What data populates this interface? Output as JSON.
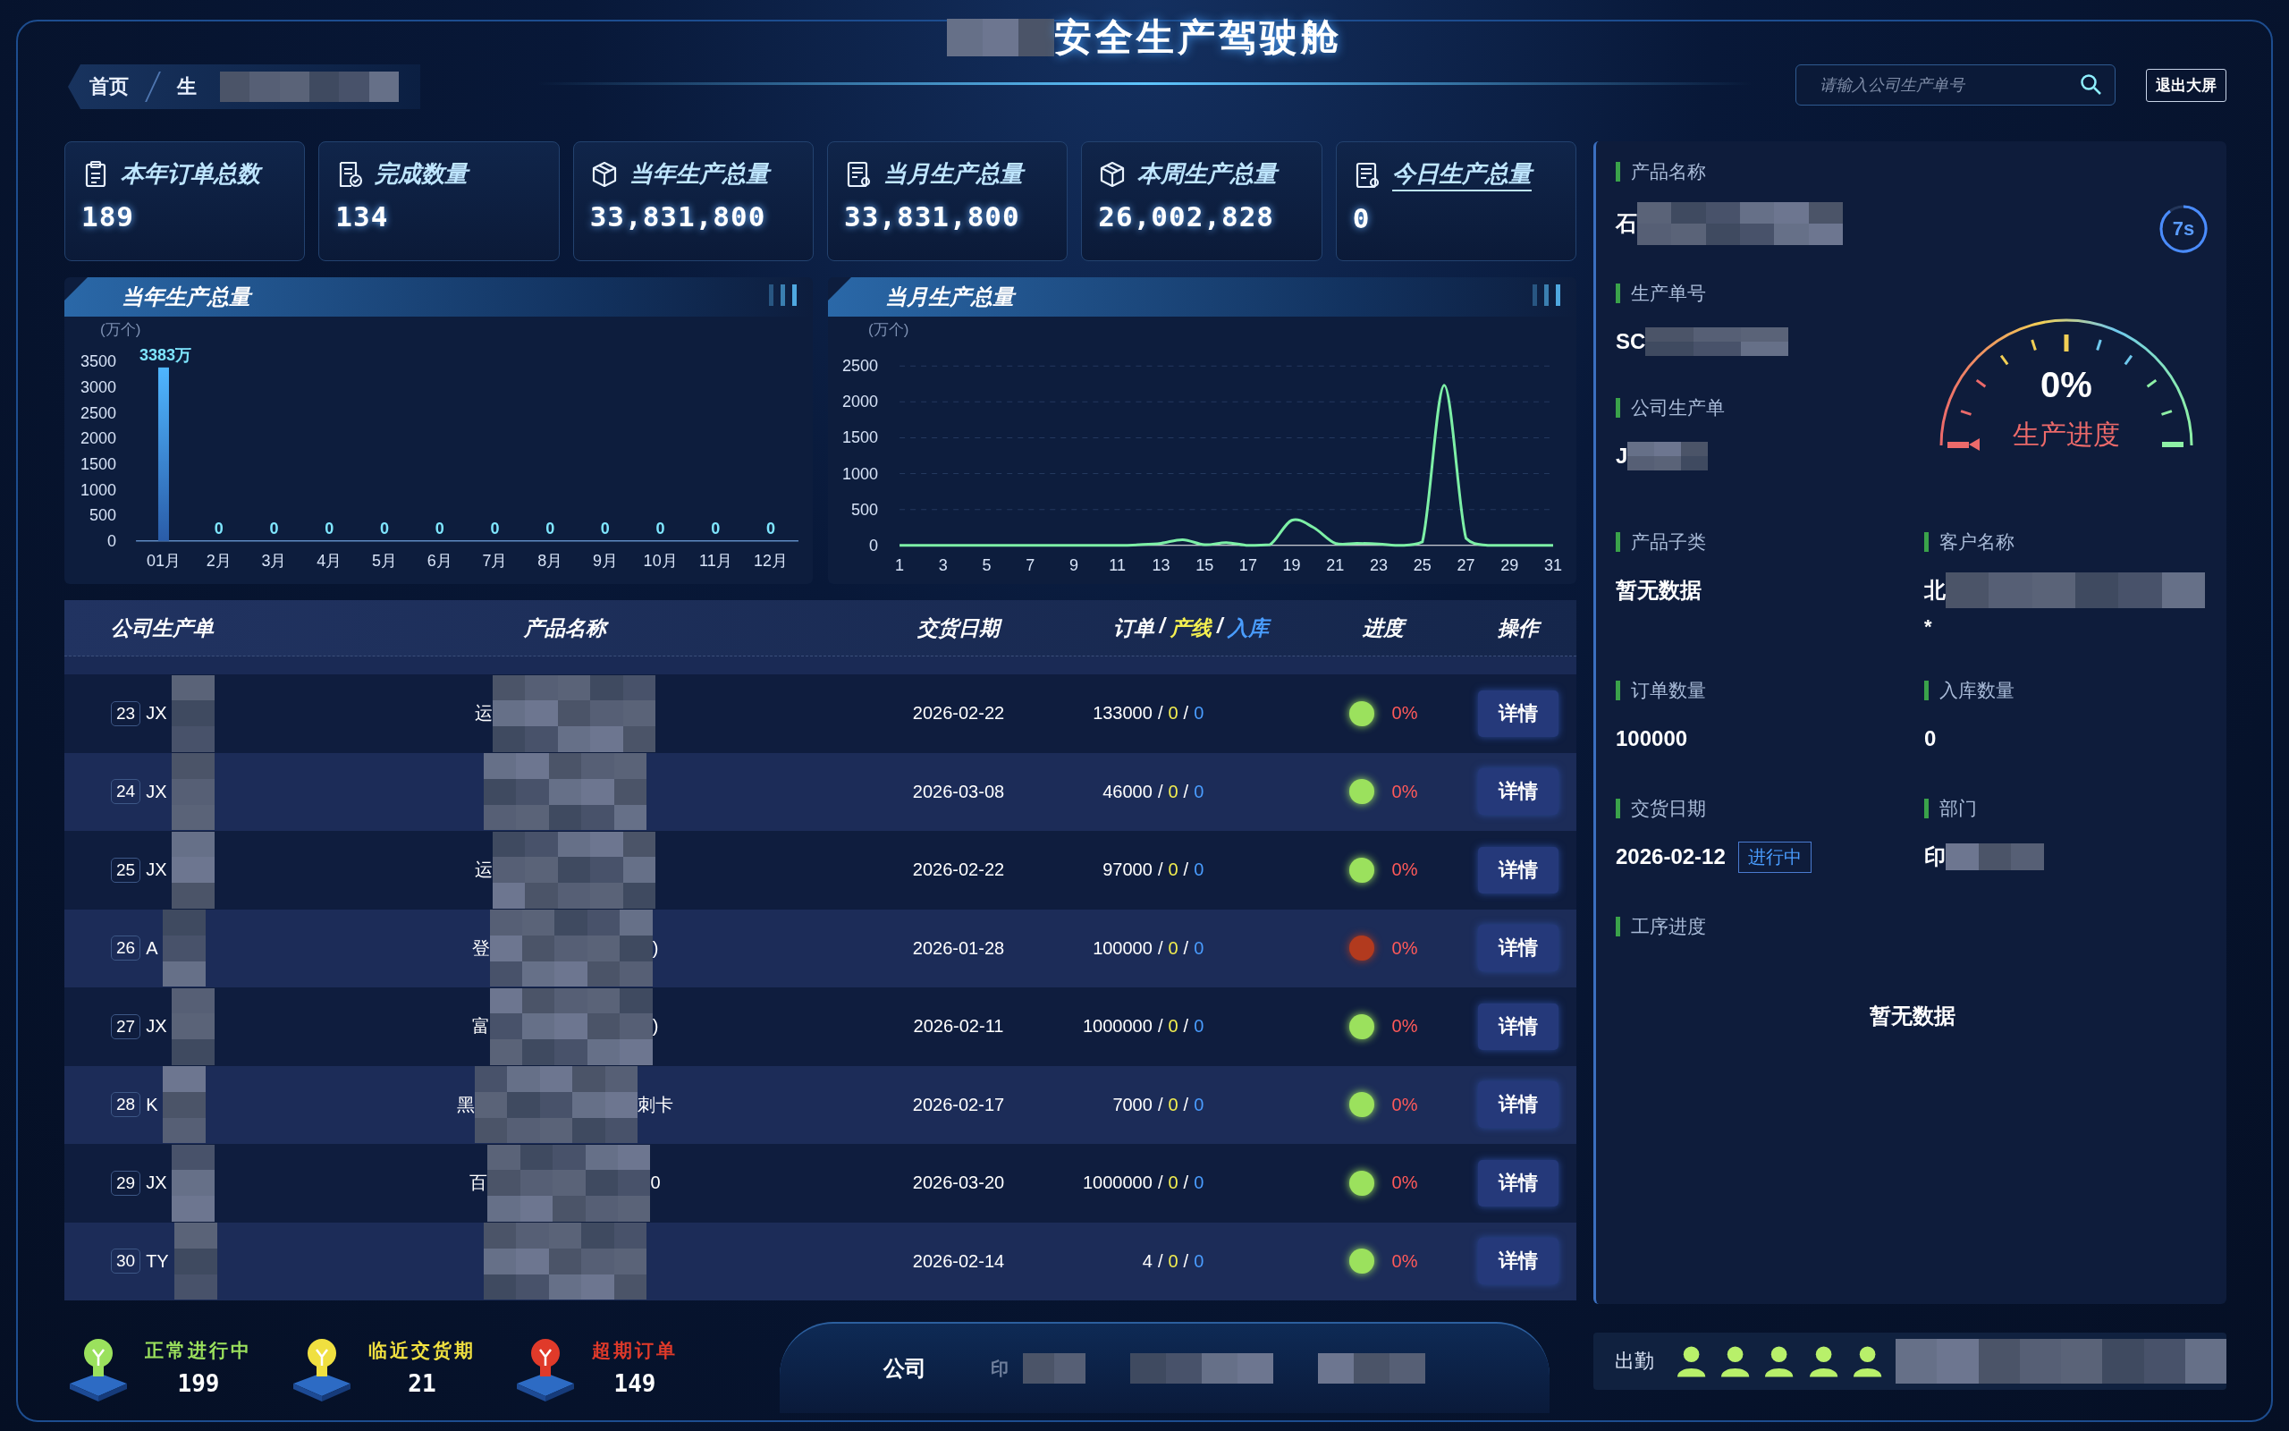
{
  "header": {
    "title": "安全生产驾驶舱",
    "title_blurred": true,
    "breadcrumb": [
      {
        "label": "首页"
      },
      {
        "label": "生",
        "blurred": true
      }
    ],
    "search": {
      "placeholder": "请输入公司生产单号"
    },
    "exit_button": "退出大屏"
  },
  "stats": [
    {
      "label": "本年订单总数",
      "value": "189",
      "selected": false
    },
    {
      "label": "完成数量",
      "value": "134",
      "selected": false
    },
    {
      "label": "当年生产总量",
      "value": "33,831,800",
      "selected": false
    },
    {
      "label": "当月生产总量",
      "value": "33,831,800",
      "selected": false
    },
    {
      "label": "本周生产总量",
      "value": "26,002,828",
      "selected": false
    },
    {
      "label": "今日生产总量",
      "value": "0",
      "selected": true
    }
  ],
  "charts": [
    {
      "title": "当年生产总量",
      "chart_data": {
        "type": "bar",
        "ylabel": "(万个)",
        "categories": [
          "01月",
          "2月",
          "3月",
          "4月",
          "5月",
          "6月",
          "7月",
          "8月",
          "9月",
          "10月",
          "11月",
          "12月"
        ],
        "values": [
          3383,
          0,
          0,
          0,
          0,
          0,
          0,
          0,
          0,
          0,
          0,
          0
        ],
        "value_labels": [
          "3383万",
          "0",
          "0",
          "0",
          "0",
          "0",
          "0",
          "0",
          "0",
          "0",
          "0",
          "0"
        ],
        "ylim": [
          0,
          3500
        ],
        "yticks": [
          0,
          500,
          1000,
          1500,
          2000,
          2500,
          3000,
          3500
        ]
      }
    },
    {
      "title": "当月生产总量",
      "chart_data": {
        "type": "line",
        "ylabel": "(万个)",
        "x": [
          1,
          2,
          3,
          4,
          5,
          6,
          7,
          8,
          9,
          10,
          11,
          12,
          13,
          14,
          15,
          16,
          17,
          18,
          19,
          20,
          21,
          22,
          23,
          24,
          25,
          26,
          27,
          28,
          29,
          30,
          31
        ],
        "series": [
          {
            "color": "#7df0a6",
            "values": [
              0,
              0,
              0,
              0,
              0,
              0,
              0,
              0,
              0,
              0,
              0,
              10,
              30,
              80,
              10,
              40,
              0,
              10,
              350,
              250,
              30,
              30,
              20,
              0,
              50,
              2230,
              100,
              0,
              0,
              0,
              0
            ]
          }
        ],
        "xticks": [
          1,
          3,
          5,
          7,
          9,
          11,
          13,
          15,
          17,
          19,
          21,
          23,
          25,
          27,
          29,
          31
        ],
        "xlim": [
          1,
          31
        ],
        "ylim": [
          0,
          2500
        ],
        "yticks": [
          0,
          500,
          1000,
          1500,
          2000,
          2500
        ],
        "grid": true
      }
    }
  ],
  "table": {
    "columns": [
      {
        "label": "公司生产单"
      },
      {
        "label": "产品名称"
      },
      {
        "label": "交货日期"
      },
      {
        "parts": [
          "订单",
          "产线",
          "入库"
        ]
      },
      {
        "label": "进度"
      },
      {
        "label": "操作"
      }
    ],
    "separator": "/",
    "rows": [
      {
        "index": "23",
        "order": "JX",
        "product": "运",
        "date": "2026-02-22",
        "qty": "133000",
        "line": "0",
        "stock": "0",
        "color": "#9be15d",
        "progress": "0%",
        "action": "详情"
      },
      {
        "index": "24",
        "order": "JX",
        "date": "2026-03-08",
        "qty": "46000",
        "line": "0",
        "stock": "0",
        "color": "#9be15d",
        "progress": "0%",
        "action": "详情"
      },
      {
        "index": "25",
        "order": "JX",
        "product": "运",
        "date": "2026-02-22",
        "qty": "97000",
        "line": "0",
        "stock": "0",
        "color": "#9be15d",
        "progress": "0%",
        "action": "详情"
      },
      {
        "index": "26",
        "order": "A",
        "product": "登",
        "product_suffix": ")",
        "date": "2026-01-28",
        "qty": "100000",
        "line": "0",
        "stock": "0",
        "color": "#b23a1e",
        "progress": "0%",
        "action": "详情"
      },
      {
        "index": "27",
        "order": "JX",
        "product": "富",
        "product_suffix": ")",
        "date": "2026-02-11",
        "qty": "1000000",
        "line": "0",
        "stock": "0",
        "color": "#9be15d",
        "progress": "0%",
        "action": "详情"
      },
      {
        "index": "28",
        "order": "K",
        "product": "黑",
        "product_suffix": "刺卡",
        "date": "2026-02-17",
        "qty": "7000",
        "line": "0",
        "stock": "0",
        "color": "#9be15d",
        "progress": "0%",
        "action": "详情"
      },
      {
        "index": "29",
        "order": "JX",
        "product": "百",
        "product_suffix": "0",
        "date": "2026-03-20",
        "qty": "1000000",
        "line": "0",
        "stock": "0",
        "color": "#9be15d",
        "progress": "0%",
        "action": "详情"
      },
      {
        "index": "30",
        "order": "TY",
        "date": "2026-02-14",
        "qty": "4",
        "line": "0",
        "stock": "0",
        "color": "#9be15d",
        "progress": "0%",
        "action": "详情"
      }
    ]
  },
  "detail": {
    "countdown": "7s",
    "fields": [
      {
        "label": "产品名称",
        "value": "石",
        "blurred": true
      },
      {
        "label": "生产单号",
        "value": "SC",
        "blurred": true
      },
      {
        "label": "公司生产单",
        "value": "J",
        "blurred": true
      }
    ],
    "gauge": {
      "value": "0%",
      "label": "生产进度"
    },
    "grid": [
      {
        "label": "产品子类",
        "value": "暂无数据"
      },
      {
        "label": "客户名称",
        "value": "北",
        "blurred": true,
        "note": "*"
      },
      {
        "label": "订单数量",
        "value": "100000"
      },
      {
        "label": "入库数量",
        "value": "0"
      },
      {
        "label": "交货日期",
        "value": "2026-02-12",
        "badge": "进行中"
      },
      {
        "label": "部门",
        "value": "印",
        "blurred": true
      }
    ],
    "process": {
      "label": "工序进度",
      "empty": "暂无数据"
    }
  },
  "legend": [
    {
      "label": "正常进行中",
      "value": "199",
      "color": "#9be15d"
    },
    {
      "label": "临近交货期",
      "value": "21",
      "color": "#f0e040"
    },
    {
      "label": "超期订单",
      "value": "149",
      "color": "#e03a2a"
    }
  ],
  "bottom_tabs": [
    {
      "label": "公司",
      "selected": true
    },
    {
      "label": "印",
      "selected": false,
      "blurred": true
    }
  ],
  "attendance": {
    "label": "出勤",
    "people": [
      {
        "kind": "person"
      },
      {
        "kind": "person"
      },
      {
        "kind": "person"
      },
      {
        "kind": "person"
      },
      {
        "kind": "person"
      }
    ],
    "blurred": true
  }
}
